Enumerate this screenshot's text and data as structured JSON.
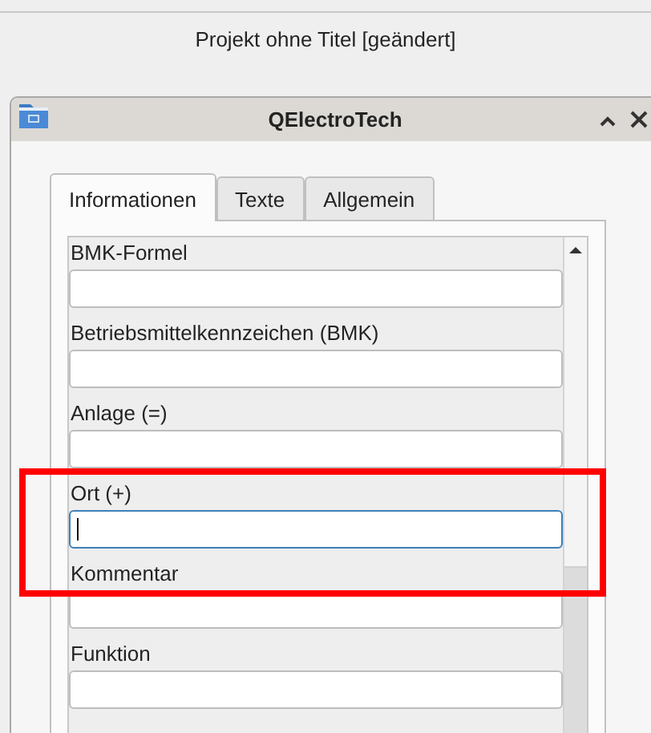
{
  "parent_window": {
    "title": "Projekt ohne Titel [geändert]"
  },
  "dialog": {
    "title": "QElectroTech",
    "tabs": [
      {
        "label": "Informationen",
        "selected": true
      },
      {
        "label": "Texte",
        "selected": false
      },
      {
        "label": "Allgemein",
        "selected": false
      }
    ],
    "fields": [
      {
        "label": "BMK-Formel",
        "focused": false,
        "highlighted": false
      },
      {
        "label": "Betriebsmittelkennzeichen (BMK)",
        "focused": false,
        "highlighted": false
      },
      {
        "label": "Anlage (=)",
        "focused": false,
        "highlighted": false
      },
      {
        "label": "Ort (+)",
        "focused": true,
        "highlighted": true
      },
      {
        "label": "Kommentar",
        "focused": false,
        "highlighted": false
      },
      {
        "label": "Funktion",
        "focused": false,
        "highlighted": false
      }
    ]
  }
}
